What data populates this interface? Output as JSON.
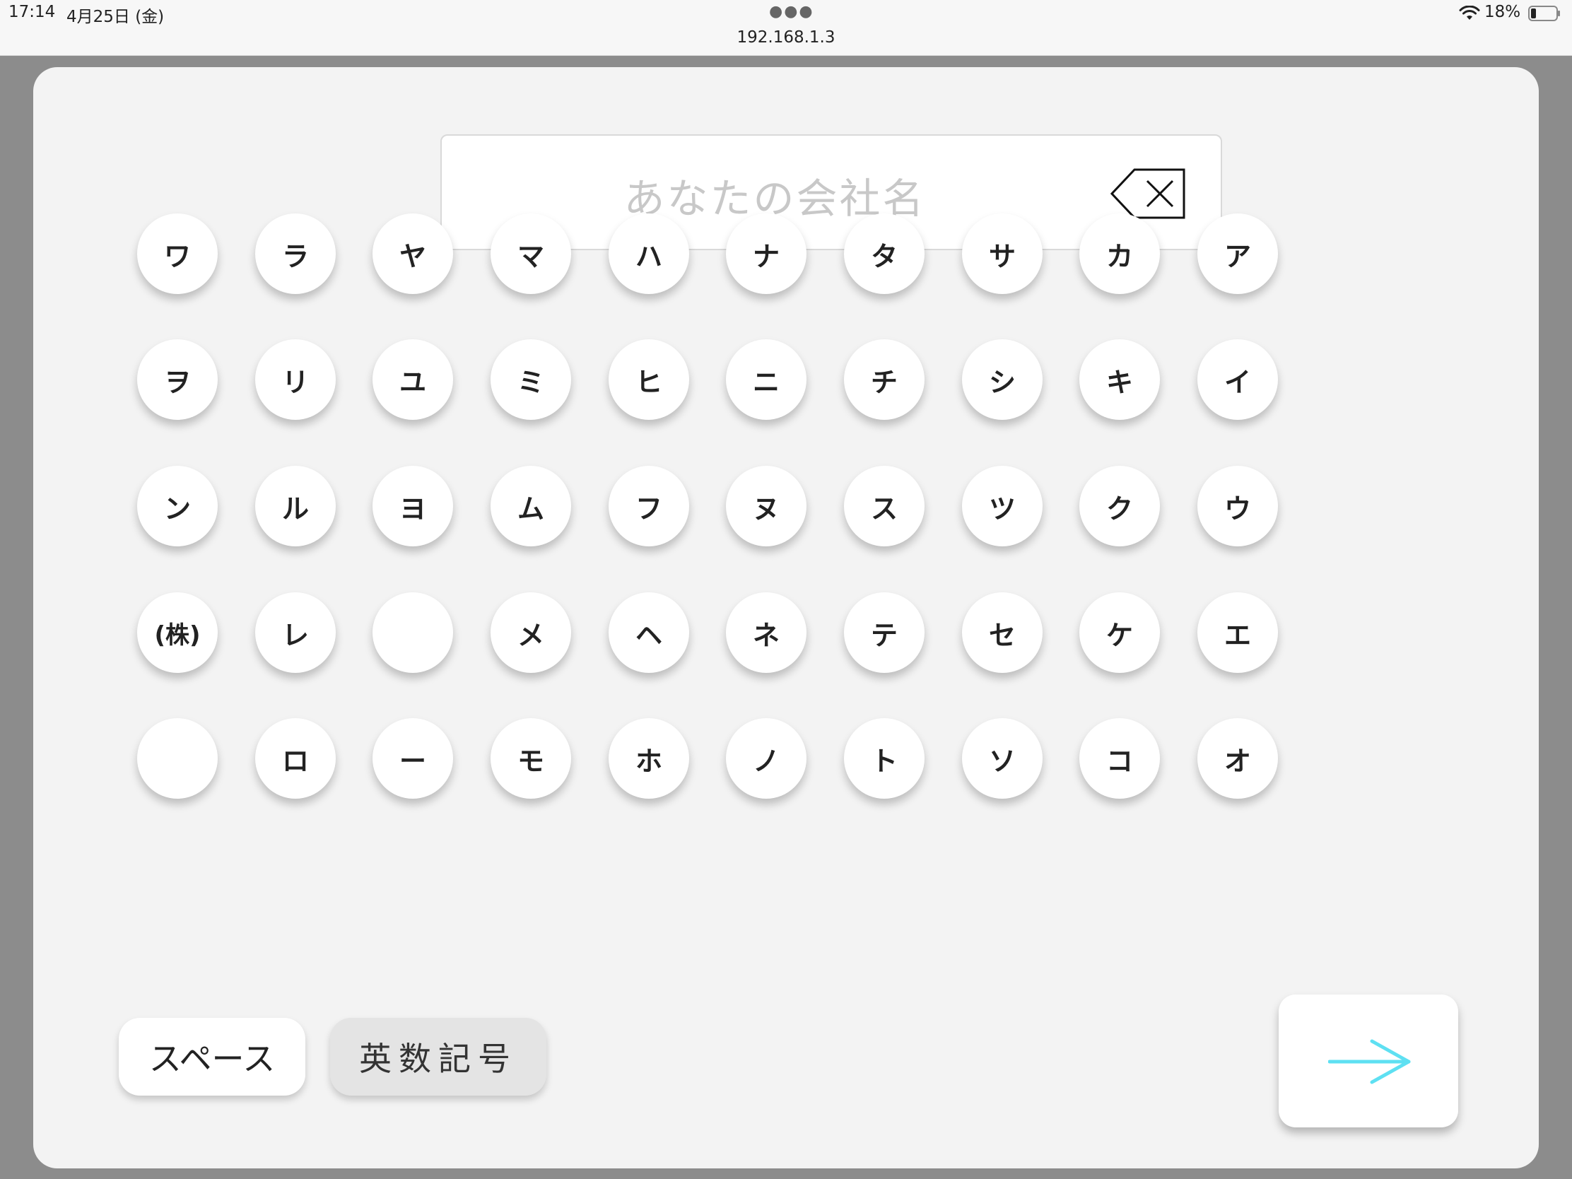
{
  "status_bar": {
    "time": "17:14",
    "date": "4月25日 (金)",
    "url": "192.168.1.3",
    "battery": "18%",
    "icons": [
      "more-dots-icon",
      "wifi-icon",
      "battery-icon"
    ]
  },
  "input": {
    "placeholder": "あなたの会社名",
    "value": ""
  },
  "keyboard": {
    "rows": [
      [
        "ワ",
        "ラ",
        "ヤ",
        "マ",
        "ハ",
        "ナ",
        "タ",
        "サ",
        "カ",
        "ア"
      ],
      [
        "ヲ",
        "リ",
        "ユ",
        "ミ",
        "ヒ",
        "ニ",
        "チ",
        "シ",
        "キ",
        "イ"
      ],
      [
        "ン",
        "ル",
        "ヨ",
        "ム",
        "フ",
        "ヌ",
        "ス",
        "ツ",
        "ク",
        "ウ"
      ],
      [
        "(株)",
        "レ",
        "",
        "メ",
        "ヘ",
        "ネ",
        "テ",
        "セ",
        "ケ",
        "エ"
      ],
      [
        "",
        "ロ",
        "ー",
        "モ",
        "ホ",
        "ノ",
        "ト",
        "ソ",
        "コ",
        "オ"
      ]
    ]
  },
  "buttons": {
    "space": "スペース",
    "alnum": "英数記号"
  },
  "colors": {
    "next_arrow": "#5ee0f2",
    "card_bg": "#f3f3f3",
    "backdrop": "#8c8c8c"
  }
}
